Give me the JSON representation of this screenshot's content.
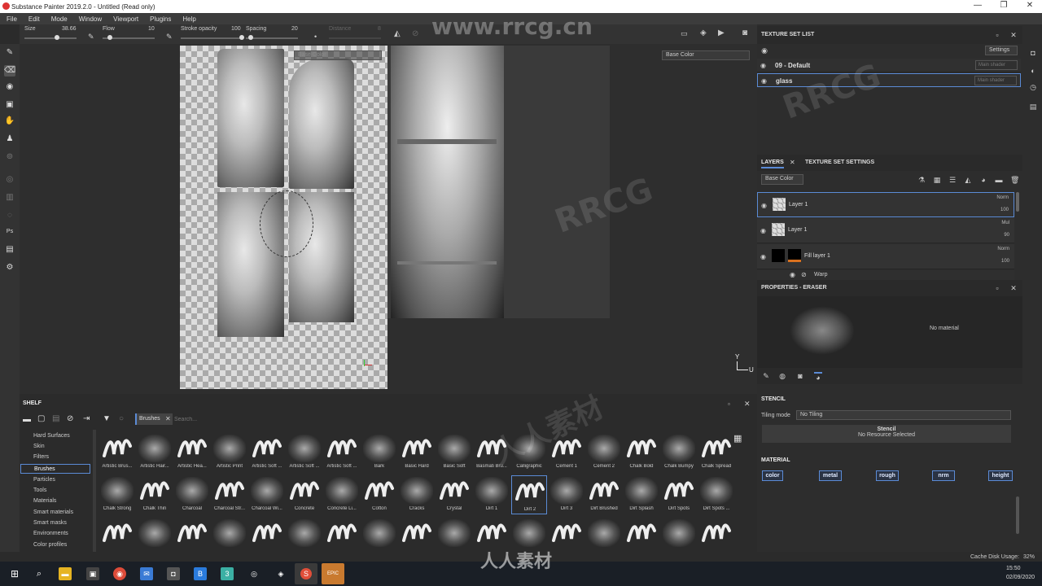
{
  "titlebar": {
    "title": "Substance Painter 2019.2.0 - Untitled (Read only)",
    "min": "—",
    "max": "❐",
    "close": "✕"
  },
  "menu": [
    "File",
    "Edit",
    "Mode",
    "Window",
    "Viewport",
    "Plugins",
    "Help"
  ],
  "tool_options": {
    "size_label": "Size",
    "size_value": "38.66",
    "flow_label": "Flow",
    "flow_value": "10",
    "stroke_opacity_label": "Stroke opacity",
    "stroke_opacity_value": "100",
    "spacing_label": "Spacing",
    "spacing_value": "20",
    "distance_label": "Distance",
    "distance_value": "8"
  },
  "viewport": {
    "channel_3d": "Base Color",
    "channel_2d": "Base Color",
    "axis_y": "Y",
    "axis_u": "U"
  },
  "texture_set_list": {
    "title": "TEXTURE SET LIST",
    "settings_label": "Settings",
    "sets": [
      {
        "name": "09 - Default",
        "shader": "Main shader"
      },
      {
        "name": "glass",
        "shader": "Main shader"
      }
    ]
  },
  "layers": {
    "tab_layers": "LAYERS",
    "tab_texture_set_settings": "TEXTURE SET SETTINGS",
    "channel": "Base Color",
    "items": [
      {
        "name": "Layer 1",
        "blend": "Norm",
        "opacity": "100"
      },
      {
        "name": "Layer 1",
        "blend": "Mul",
        "opacity": "90"
      },
      {
        "name": "Fill layer 1",
        "blend": "Norm",
        "opacity": "100"
      }
    ],
    "sub_item": "Warp"
  },
  "properties": {
    "title": "PROPERTIES - ERASER",
    "no_material": "No material",
    "stencil_header": "STENCIL",
    "tiling_label": "Tiling mode",
    "tiling_value": "No Tiling",
    "stencil_title": "Stencil",
    "stencil_sub": "No Resource Selected",
    "material_header": "MATERIAL",
    "channels": [
      "color",
      "metal",
      "rough",
      "nrm",
      "height"
    ]
  },
  "shelf": {
    "title": "SHELF",
    "filter_tag": "Brushes",
    "search_placeholder": "Search...",
    "categories": [
      "Hard Surfaces",
      "Skin",
      "Filters",
      "Brushes",
      "Particles",
      "Tools",
      "Materials",
      "Smart materials",
      "Smart masks",
      "Environments",
      "Color profiles"
    ],
    "selected_category": "Brushes",
    "brushes_row1": [
      "Artistic Brus...",
      "Artistic Hair...",
      "Artistic Hea...",
      "Artistic Print",
      "Artistic Soft ...",
      "Artistic Soft ...",
      "Artistic Soft ...",
      "Bark",
      "Basic Hard",
      "Basic Soft",
      "Basmati Bru...",
      "Calligraphic",
      "Cement 1",
      "Cement 2",
      "Chalk Bold",
      "Chalk Bumpy",
      "Chalk Spread"
    ],
    "brushes_row2": [
      "Chalk Strong",
      "Chalk Thin",
      "Charcoal",
      "Charcoal Str...",
      "Charcoal Wi...",
      "Concrete",
      "Concrete Li...",
      "Cotton",
      "Cracks",
      "Crystal",
      "Dirt 1",
      "Dirt 2",
      "Dirt 3",
      "Dirt Brushed",
      "Dirt Splash",
      "Dirt Spots",
      "Dirt Spots ..."
    ],
    "selected_brush": "Dirt 2"
  },
  "status": {
    "cache_label": "Cache Disk Usage:",
    "cache_value": "32%"
  },
  "taskbar": {
    "time": "15:50",
    "date": "02/09/2020"
  },
  "watermarks": [
    "www.rrcg.cn",
    "RRCG",
    "人人素材"
  ]
}
